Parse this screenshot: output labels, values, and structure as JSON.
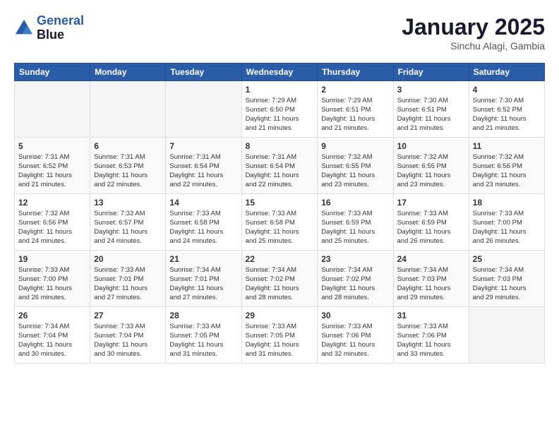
{
  "header": {
    "logo_line1": "General",
    "logo_line2": "Blue",
    "month": "January 2025",
    "location": "Sinchu Alagi, Gambia"
  },
  "days_of_week": [
    "Sunday",
    "Monday",
    "Tuesday",
    "Wednesday",
    "Thursday",
    "Friday",
    "Saturday"
  ],
  "weeks": [
    [
      {
        "day": "",
        "content": ""
      },
      {
        "day": "",
        "content": ""
      },
      {
        "day": "",
        "content": ""
      },
      {
        "day": "1",
        "content": "Sunrise: 7:29 AM\nSunset: 6:50 PM\nDaylight: 11 hours\nand 21 minutes."
      },
      {
        "day": "2",
        "content": "Sunrise: 7:29 AM\nSunset: 6:51 PM\nDaylight: 11 hours\nand 21 minutes."
      },
      {
        "day": "3",
        "content": "Sunrise: 7:30 AM\nSunset: 6:51 PM\nDaylight: 11 hours\nand 21 minutes."
      },
      {
        "day": "4",
        "content": "Sunrise: 7:30 AM\nSunset: 6:52 PM\nDaylight: 11 hours\nand 21 minutes."
      }
    ],
    [
      {
        "day": "5",
        "content": "Sunrise: 7:31 AM\nSunset: 6:52 PM\nDaylight: 11 hours\nand 21 minutes."
      },
      {
        "day": "6",
        "content": "Sunrise: 7:31 AM\nSunset: 6:53 PM\nDaylight: 11 hours\nand 22 minutes."
      },
      {
        "day": "7",
        "content": "Sunrise: 7:31 AM\nSunset: 6:54 PM\nDaylight: 11 hours\nand 22 minutes."
      },
      {
        "day": "8",
        "content": "Sunrise: 7:31 AM\nSunset: 6:54 PM\nDaylight: 11 hours\nand 22 minutes."
      },
      {
        "day": "9",
        "content": "Sunrise: 7:32 AM\nSunset: 6:55 PM\nDaylight: 11 hours\nand 23 minutes."
      },
      {
        "day": "10",
        "content": "Sunrise: 7:32 AM\nSunset: 6:55 PM\nDaylight: 11 hours\nand 23 minutes."
      },
      {
        "day": "11",
        "content": "Sunrise: 7:32 AM\nSunset: 6:56 PM\nDaylight: 11 hours\nand 23 minutes."
      }
    ],
    [
      {
        "day": "12",
        "content": "Sunrise: 7:32 AM\nSunset: 6:56 PM\nDaylight: 11 hours\nand 24 minutes."
      },
      {
        "day": "13",
        "content": "Sunrise: 7:33 AM\nSunset: 6:57 PM\nDaylight: 11 hours\nand 24 minutes."
      },
      {
        "day": "14",
        "content": "Sunrise: 7:33 AM\nSunset: 6:58 PM\nDaylight: 11 hours\nand 24 minutes."
      },
      {
        "day": "15",
        "content": "Sunrise: 7:33 AM\nSunset: 6:58 PM\nDaylight: 11 hours\nand 25 minutes."
      },
      {
        "day": "16",
        "content": "Sunrise: 7:33 AM\nSunset: 6:59 PM\nDaylight: 11 hours\nand 25 minutes."
      },
      {
        "day": "17",
        "content": "Sunrise: 7:33 AM\nSunset: 6:59 PM\nDaylight: 11 hours\nand 26 minutes."
      },
      {
        "day": "18",
        "content": "Sunrise: 7:33 AM\nSunset: 7:00 PM\nDaylight: 11 hours\nand 26 minutes."
      }
    ],
    [
      {
        "day": "19",
        "content": "Sunrise: 7:33 AM\nSunset: 7:00 PM\nDaylight: 11 hours\nand 26 minutes."
      },
      {
        "day": "20",
        "content": "Sunrise: 7:33 AM\nSunset: 7:01 PM\nDaylight: 11 hours\nand 27 minutes."
      },
      {
        "day": "21",
        "content": "Sunrise: 7:34 AM\nSunset: 7:01 PM\nDaylight: 11 hours\nand 27 minutes."
      },
      {
        "day": "22",
        "content": "Sunrise: 7:34 AM\nSunset: 7:02 PM\nDaylight: 11 hours\nand 28 minutes."
      },
      {
        "day": "23",
        "content": "Sunrise: 7:34 AM\nSunset: 7:02 PM\nDaylight: 11 hours\nand 28 minutes."
      },
      {
        "day": "24",
        "content": "Sunrise: 7:34 AM\nSunset: 7:03 PM\nDaylight: 11 hours\nand 29 minutes."
      },
      {
        "day": "25",
        "content": "Sunrise: 7:34 AM\nSunset: 7:03 PM\nDaylight: 11 hours\nand 29 minutes."
      }
    ],
    [
      {
        "day": "26",
        "content": "Sunrise: 7:34 AM\nSunset: 7:04 PM\nDaylight: 11 hours\nand 30 minutes."
      },
      {
        "day": "27",
        "content": "Sunrise: 7:33 AM\nSunset: 7:04 PM\nDaylight: 11 hours\nand 30 minutes."
      },
      {
        "day": "28",
        "content": "Sunrise: 7:33 AM\nSunset: 7:05 PM\nDaylight: 11 hours\nand 31 minutes."
      },
      {
        "day": "29",
        "content": "Sunrise: 7:33 AM\nSunset: 7:05 PM\nDaylight: 11 hours\nand 31 minutes."
      },
      {
        "day": "30",
        "content": "Sunrise: 7:33 AM\nSunset: 7:06 PM\nDaylight: 11 hours\nand 32 minutes."
      },
      {
        "day": "31",
        "content": "Sunrise: 7:33 AM\nSunset: 7:06 PM\nDaylight: 11 hours\nand 33 minutes."
      },
      {
        "day": "",
        "content": ""
      }
    ]
  ]
}
